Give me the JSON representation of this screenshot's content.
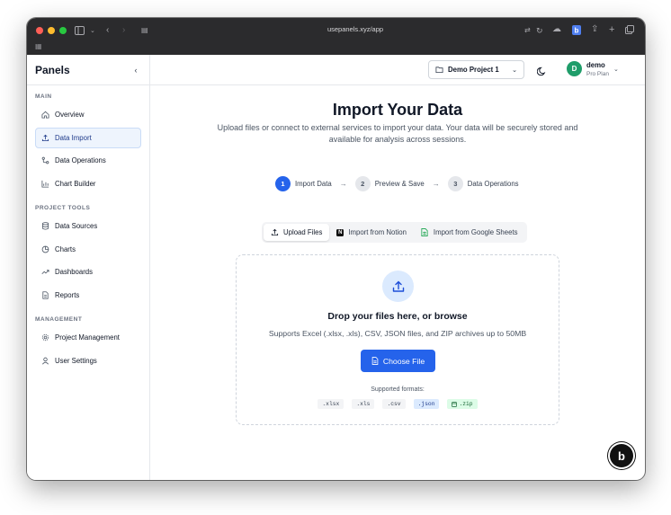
{
  "browser": {
    "url": "usepanels.xyz/app"
  },
  "sidebar": {
    "brand": "Panels",
    "sections": [
      {
        "title": "MAIN",
        "items": [
          "Overview",
          "Data Import",
          "Data Operations",
          "Chart Builder"
        ]
      },
      {
        "title": "PROJECT TOOLS",
        "items": [
          "Data Sources",
          "Charts",
          "Dashboards",
          "Reports"
        ]
      },
      {
        "title": "MANAGEMENT",
        "items": [
          "Project Management",
          "User Settings"
        ]
      }
    ],
    "active_item": "Data Import"
  },
  "topbar": {
    "project": "Demo Project 1",
    "user_initial": "D",
    "user_name": "demo",
    "user_plan": "Pro Plan"
  },
  "main": {
    "title": "Import Your Data",
    "subtitle": "Upload files or connect to external services to import your data. Your data will be securely stored and available for analysis across sessions.",
    "steps": [
      {
        "num": "1",
        "label": "Import Data",
        "active": true
      },
      {
        "num": "2",
        "label": "Preview & Save",
        "active": false
      },
      {
        "num": "3",
        "label": "Data Operations",
        "active": false
      }
    ],
    "tabs": [
      "Upload Files",
      "Import from Notion",
      "Import from Google Sheets"
    ],
    "active_tab": "Upload Files",
    "dropzone": {
      "title": "Drop your files here, or browse",
      "subtitle": "Supports Excel (.xlsx, .xls), CSV, JSON files, and ZIP archives up to 50MB",
      "button": "Choose File",
      "formats_label": "Supported formats:",
      "formats": [
        ".xlsx",
        ".xls",
        ".csv",
        ".json",
        ".zip"
      ]
    }
  },
  "floating_badge": "b",
  "colors": {
    "accent": "#2563eb",
    "avatar": "#1f9d6a",
    "active_nav_bg": "#eef4fd"
  }
}
